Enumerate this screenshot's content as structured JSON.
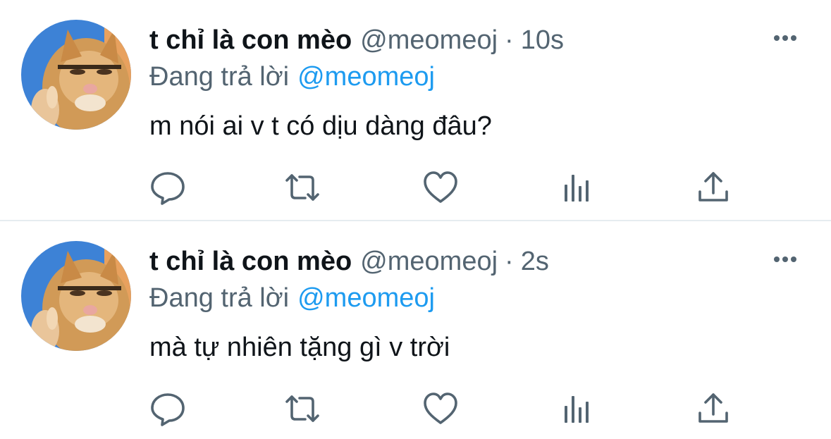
{
  "tweets": [
    {
      "display_name": "t chỉ là con mèo",
      "handle": "@meomeoj",
      "separator": "·",
      "time": "10s",
      "replying_to_label": "Đang trả lời",
      "replying_to_handle": "@meomeoj",
      "text": "m nói ai v t có dịu dàng đâu?",
      "actions": [
        "reply-icon",
        "retweet-icon",
        "like-icon",
        "views-icon",
        "share-icon"
      ]
    },
    {
      "display_name": "t chỉ là con mèo",
      "handle": "@meomeoj",
      "separator": "·",
      "time": "2s",
      "replying_to_label": "Đang trả lời",
      "replying_to_handle": "@meomeoj",
      "text": "mà tự nhiên tặng gì v trời",
      "actions": [
        "reply-icon",
        "retweet-icon",
        "like-icon",
        "views-icon",
        "share-icon"
      ]
    }
  ],
  "colors": {
    "text_primary": "#0f1419",
    "text_secondary": "#536471",
    "mention": "#1d9bf0",
    "icon": "#536471",
    "divider": "#e6ecf0"
  }
}
